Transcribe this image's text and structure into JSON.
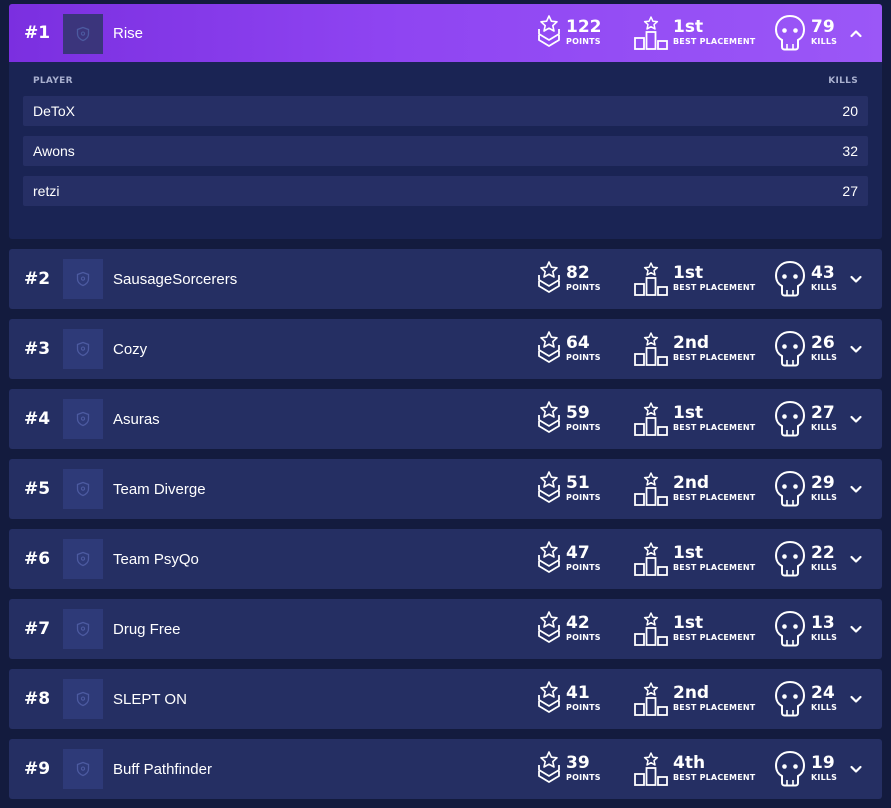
{
  "labels": {
    "points": "POINTS",
    "best_placement": "BEST PLACEMENT",
    "kills": "KILLS",
    "player_col": "PLAYER",
    "kills_col": "KILLS"
  },
  "colors": {
    "background": "#131b3e",
    "row": "#252f63",
    "expanded_row": "#8f45f2",
    "detail_panel": "#1a2454"
  },
  "icons": {
    "team_logo": "shield-icon",
    "points": "rank-chevron-star-icon",
    "placement": "podium-star-icon",
    "kills": "skull-icon",
    "expand": "chevron-down-icon",
    "collapse": "chevron-up-icon"
  },
  "teams": [
    {
      "rank": "#1",
      "name": "Rise",
      "points": "122",
      "best_placement": "1st",
      "kills": "79",
      "expanded": true,
      "players": [
        {
          "name": "DeToX",
          "kills": "20"
        },
        {
          "name": "Awons",
          "kills": "32"
        },
        {
          "name": "retzi",
          "kills": "27"
        }
      ]
    },
    {
      "rank": "#2",
      "name": "SausageSorcerers",
      "points": "82",
      "best_placement": "1st",
      "kills": "43"
    },
    {
      "rank": "#3",
      "name": "Cozy",
      "points": "64",
      "best_placement": "2nd",
      "kills": "26"
    },
    {
      "rank": "#4",
      "name": "Asuras",
      "points": "59",
      "best_placement": "1st",
      "kills": "27"
    },
    {
      "rank": "#5",
      "name": "Team Diverge",
      "points": "51",
      "best_placement": "2nd",
      "kills": "29"
    },
    {
      "rank": "#6",
      "name": "Team PsyQo",
      "points": "47",
      "best_placement": "1st",
      "kills": "22"
    },
    {
      "rank": "#7",
      "name": "Drug Free",
      "points": "42",
      "best_placement": "1st",
      "kills": "13"
    },
    {
      "rank": "#8",
      "name": "SLEPT ON",
      "points": "41",
      "best_placement": "2nd",
      "kills": "24"
    },
    {
      "rank": "#9",
      "name": "Buff Pathfinder",
      "points": "39",
      "best_placement": "4th",
      "kills": "19"
    }
  ]
}
